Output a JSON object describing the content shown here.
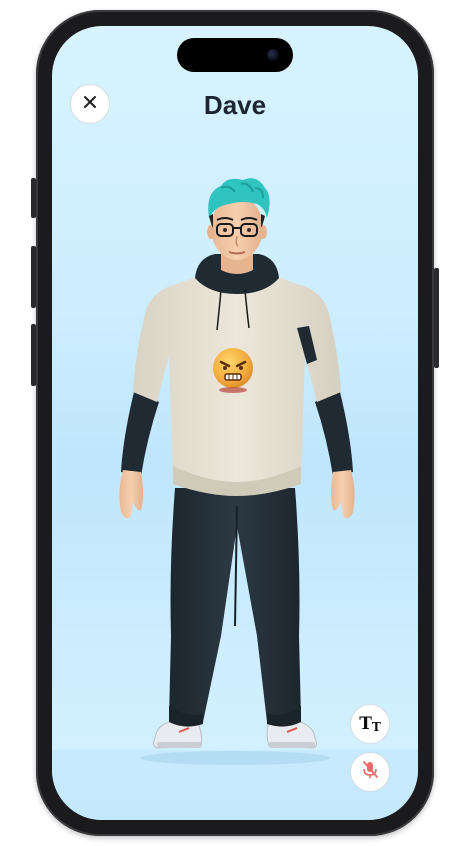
{
  "header": {
    "title": "Dave"
  },
  "icons": {
    "close": "close-icon",
    "text_size": "text-size-icon",
    "text_size_glyph_big": "T",
    "text_size_glyph_small": "T",
    "microphone": "microphone-muted-icon"
  },
  "avatar": {
    "name": "avatar-figure"
  },
  "colors": {
    "background_top": "#d7f3ff",
    "background_mid": "#bfe6fb",
    "title_text": "#1c2530",
    "mic_muted": "#e86a6a",
    "hair": "#2fc4bf",
    "shirt": "#e7e1d3",
    "sleeves": "#1f2a33",
    "pants": "#243039"
  }
}
